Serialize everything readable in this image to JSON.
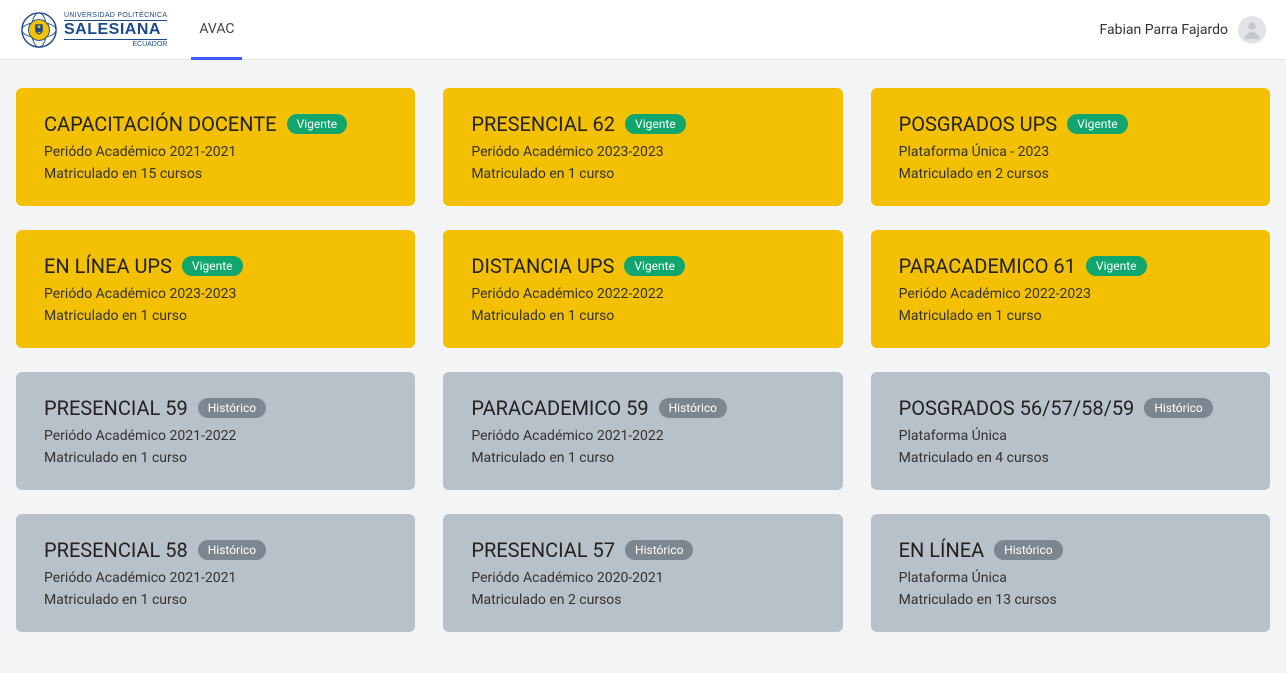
{
  "header": {
    "logo": {
      "top": "UNIVERSIDAD POLITÉCNICA",
      "main": "SALESIANA",
      "sub": "ECUADOR"
    },
    "nav": {
      "avac": "AVAC"
    },
    "user_name": "Fabian Parra Fajardo"
  },
  "badges": {
    "vigente": "Vigente",
    "historico": "Histórico"
  },
  "cards": [
    {
      "title": "CAPACITACIÓN DOCENTE",
      "status": "vigente",
      "period": "Periódo Académico 2021-2021",
      "enroll": "Matriculado en 15 cursos"
    },
    {
      "title": "PRESENCIAL 62",
      "status": "vigente",
      "period": "Periódo Académico 2023-2023",
      "enroll": "Matriculado en 1 curso"
    },
    {
      "title": "POSGRADOS UPS",
      "status": "vigente",
      "period": "Plataforma Única - 2023",
      "enroll": "Matriculado en 2 cursos"
    },
    {
      "title": "EN LÍNEA UPS",
      "status": "vigente",
      "period": "Periódo Académico 2023-2023",
      "enroll": "Matriculado en 1 curso"
    },
    {
      "title": "DISTANCIA UPS",
      "status": "vigente",
      "period": "Periódo Académico 2022-2022",
      "enroll": "Matriculado en 1 curso"
    },
    {
      "title": "PARACADEMICO 61",
      "status": "vigente",
      "period": "Periódo Académico 2022-2023",
      "enroll": "Matriculado en 1 curso"
    },
    {
      "title": "PRESENCIAL 59",
      "status": "historico",
      "period": "Periódo Académico 2021-2022",
      "enroll": "Matriculado en 1 curso"
    },
    {
      "title": "PARACADEMICO 59",
      "status": "historico",
      "period": "Periódo Académico 2021-2022",
      "enroll": "Matriculado en 1 curso"
    },
    {
      "title": "POSGRADOS 56/57/58/59",
      "status": "historico",
      "period": "Plataforma Única",
      "enroll": "Matriculado en 4 cursos"
    },
    {
      "title": "PRESENCIAL 58",
      "status": "historico",
      "period": "Periódo Académico 2021-2021",
      "enroll": "Matriculado en 1 curso"
    },
    {
      "title": "PRESENCIAL 57",
      "status": "historico",
      "period": "Periódo Académico 2020-2021",
      "enroll": "Matriculado en 2 cursos"
    },
    {
      "title": "EN LÍNEA",
      "status": "historico",
      "period": "Plataforma Única",
      "enroll": "Matriculado en 13 cursos"
    }
  ]
}
